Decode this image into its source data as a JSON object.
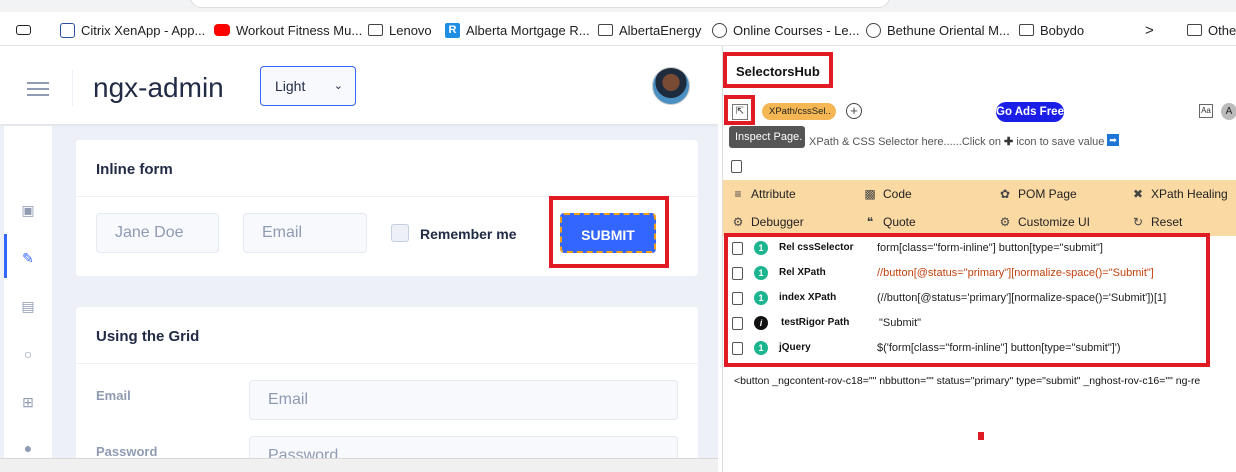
{
  "bookmarks": [
    {
      "label": "",
      "icon": "device-icon"
    },
    {
      "label": "Citrix XenApp - App...",
      "icon": "citrix-icon"
    },
    {
      "label": "Workout Fitness Mu...",
      "icon": "youtube-icon"
    },
    {
      "label": "Lenovo",
      "icon": "folder-icon"
    },
    {
      "label": "Alberta Mortgage R...",
      "icon": "r-icon"
    },
    {
      "label": "AlbertaEnergy",
      "icon": "folder-icon"
    },
    {
      "label": "Online Courses - Le...",
      "icon": "globe-icon"
    },
    {
      "label": "Bethune Oriental M...",
      "icon": "globe-icon"
    },
    {
      "label": "Bobydo",
      "icon": "folder-icon"
    },
    {
      "label": ">",
      "icon": "chevron-right-icon"
    },
    {
      "label": "Othe",
      "icon": "folder-icon"
    }
  ],
  "app": {
    "brand": "ngx-admin",
    "theme": "Light",
    "inline_form": {
      "title": "Inline form",
      "name_placeholder": "Jane Doe",
      "email_placeholder": "Email",
      "remember_label": "Remember me",
      "submit_label": "SUBMIT"
    },
    "grid_form": {
      "title": "Using the Grid",
      "email_label": "Email",
      "email_placeholder": "Email",
      "password_label": "Password",
      "password_placeholder": "Password"
    }
  },
  "selectorshub": {
    "title": "SelectorsHub",
    "xpath_pill": "XPath/cssSel..",
    "go_ads": "Go Ads Free",
    "tooltip": "Inspect Page.",
    "placeholder_text": "XPath & CSS Selector here......Click on",
    "placeholder_suffix": "icon to save value",
    "menu": [
      {
        "label": "Attribute",
        "icon": "sliders-icon"
      },
      {
        "label": "Code",
        "icon": "code-icon"
      },
      {
        "label": "POM Page",
        "icon": "pom-icon"
      },
      {
        "label": "XPath Healing",
        "icon": "healing-icon"
      },
      {
        "label": "Debugger",
        "icon": "bug-icon"
      },
      {
        "label": "Quote",
        "icon": "quote-icon"
      },
      {
        "label": "Customize UI",
        "icon": "gear-icon"
      },
      {
        "label": "Reset",
        "icon": "reset-icon"
      }
    ],
    "results": [
      {
        "label": "Rel cssSelector",
        "badge": "1",
        "value": "form[class=\"form-inline\"] button[type=\"submit\"]"
      },
      {
        "label": "Rel XPath",
        "badge": "1",
        "value": "//button[@status=\"primary\"][normalize-space()=\"Submit\"]"
      },
      {
        "label": "index XPath",
        "badge": "1",
        "value": "(//button[@status='primary'][normalize-space()='Submit'])[1]"
      },
      {
        "label": "testRigor Path",
        "badge": "i",
        "value": "\"Submit\""
      },
      {
        "label": "jQuery",
        "badge": "1",
        "value": "$('form[class=\"form-inline\"] button[type=\"submit\"]')"
      }
    ],
    "html_snippet": "<button _ngcontent-rov-c18=\"\" nbbutton=\"\" status=\"primary\" type=\"submit\" _nghost-rov-c16=\"\" ng-re"
  },
  "colors": {
    "accent": "#3366ff",
    "highlight": "#e01b24",
    "menu_band": "#fad9a3",
    "pill": "#f4b753",
    "go_ads": "#1a1ee6",
    "badge": "#1cb58f"
  }
}
